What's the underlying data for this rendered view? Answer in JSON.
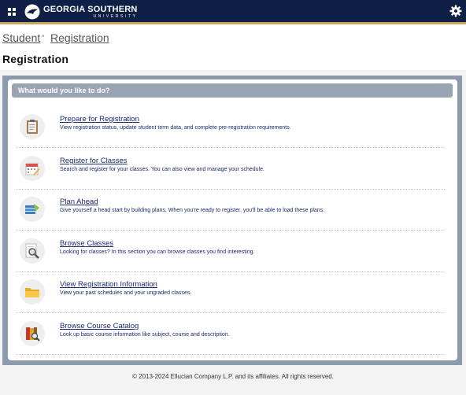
{
  "header": {
    "logo_main": "GEORGIA SOUTHERN",
    "logo_sub": "UNIVERSITY",
    "apps_icon": "grid-icon",
    "settings_icon": "gear-icon",
    "bar_color": "#0f1f45",
    "accent_color": "#c9a45c"
  },
  "breadcrumb": {
    "items": [
      "Student",
      "Registration"
    ]
  },
  "page": {
    "title": "Registration"
  },
  "panel": {
    "header": "What would you like to do?"
  },
  "items": [
    {
      "title": "Prepare for Registration",
      "desc": "View registration status, update student term data, and complete pre-registration requirements.",
      "icon": "clipboard-icon"
    },
    {
      "title": "Register for Classes",
      "desc": "Search and register for your classes. You can also view and manage your schedule.",
      "icon": "calendar-edit-icon"
    },
    {
      "title": "Plan Ahead",
      "desc": "Give yourself a head start by building plans. When you're ready to register, you'll be able to load these plans.",
      "icon": "plan-list-icon"
    },
    {
      "title": "Browse Classes",
      "desc": "Looking for classes? In this section you can browse classes you find interesting.",
      "icon": "magnifier-document-icon"
    },
    {
      "title": "View Registration Information",
      "desc": "View your past schedules and your ungraded classes.",
      "icon": "folder-icon"
    },
    {
      "title": "Browse Course Catalog",
      "desc": "Look up basic course information like subject, course and description.",
      "icon": "catalog-books-icon"
    }
  ],
  "footer": {
    "text": "© 2013-2024 Ellucian Company L.P. and its affiliates. All rights reserved."
  }
}
